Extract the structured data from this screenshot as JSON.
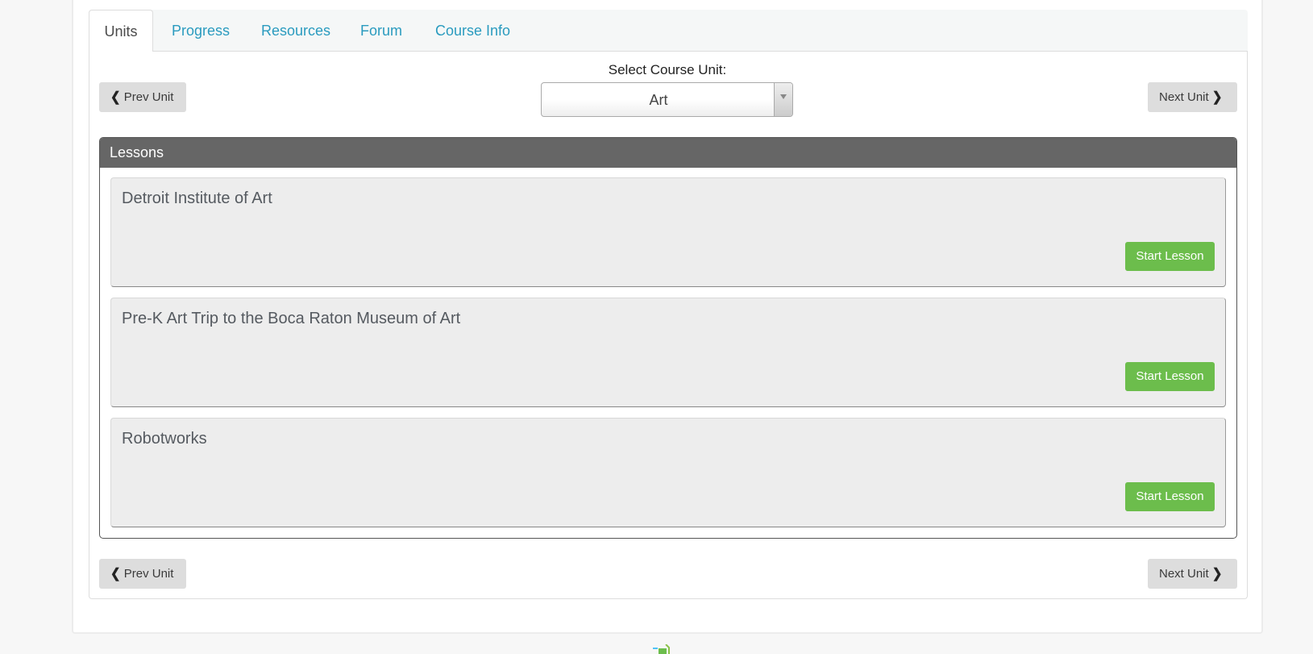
{
  "tabs": [
    {
      "label": "Units",
      "active": true
    },
    {
      "label": "Progress",
      "active": false
    },
    {
      "label": "Resources",
      "active": false
    },
    {
      "label": "Forum",
      "active": false
    },
    {
      "label": "Course Info",
      "active": false
    }
  ],
  "unit_nav": {
    "prev_label": "Prev Unit",
    "next_label": "Next Unit",
    "prev_icon": "chevron-left-icon",
    "next_icon": "chevron-right-icon",
    "select_label": "Select Course Unit:",
    "selected_unit": "Art"
  },
  "lessons": {
    "header": "Lessons",
    "items": [
      {
        "title": "Detroit Institute of Art",
        "button": "Start Lesson"
      },
      {
        "title": "Pre-K Art Trip to the Boca Raton Museum of Art",
        "button": "Start Lesson"
      },
      {
        "title": "Robotworks",
        "button": "Start Lesson"
      }
    ]
  },
  "colors": {
    "tab_link": "#2a9bbf",
    "lessons_header_bg": "#666666",
    "start_button": "#6cbd4c",
    "nav_button_bg": "#dddddd"
  }
}
